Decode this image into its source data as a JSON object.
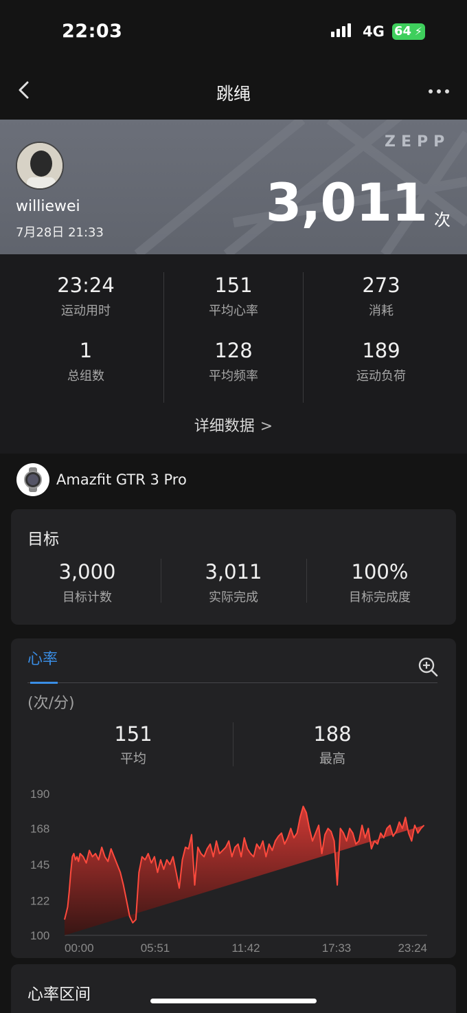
{
  "status_bar": {
    "time": "22:03",
    "network": "4G",
    "battery": "64"
  },
  "nav": {
    "title": "跳绳"
  },
  "hero": {
    "brand": "ZEPP",
    "username": "williewei",
    "datetime": "7月28日 21:33",
    "count": "3,011",
    "count_unit": "次"
  },
  "stats": [
    {
      "value": "23:24",
      "label": "运动用时"
    },
    {
      "value": "151",
      "label": "平均心率"
    },
    {
      "value": "273",
      "label": "消耗"
    },
    {
      "value": "1",
      "label": "总组数"
    },
    {
      "value": "128",
      "label": "平均频率"
    },
    {
      "value": "189",
      "label": "运动负荷"
    }
  ],
  "detail_link": "详细数据",
  "device": {
    "name": "Amazfit GTR 3 Pro"
  },
  "goal": {
    "title": "目标",
    "items": [
      {
        "value": "3,000",
        "label": "目标计数"
      },
      {
        "value": "3,011",
        "label": "实际完成"
      },
      {
        "value": "100%",
        "label": "目标完成度"
      }
    ]
  },
  "heart_rate": {
    "tab": "心率",
    "unit": "(次/分)",
    "avg": {
      "value": "151",
      "label": "平均"
    },
    "max": {
      "value": "188",
      "label": "最高"
    }
  },
  "chart_data": {
    "type": "area",
    "y_ticks": [
      "190",
      "168",
      "145",
      "122",
      "100"
    ],
    "x_ticks": [
      "00:00",
      "05:51",
      "11:42",
      "17:33",
      "23:24"
    ],
    "ylim": [
      100,
      190
    ],
    "xlim": [
      0,
      23.4
    ],
    "x": [
      0.0,
      0.1,
      0.2,
      0.3,
      0.4,
      0.5,
      0.6,
      0.7,
      0.8,
      0.9,
      1.0,
      1.2,
      1.4,
      1.6,
      1.8,
      2.0,
      2.2,
      2.4,
      2.6,
      2.8,
      3.0,
      3.2,
      3.4,
      3.6,
      3.8,
      4.0,
      4.2,
      4.4,
      4.6,
      4.8,
      5.0,
      5.2,
      5.4,
      5.6,
      5.8,
      6.0,
      6.2,
      6.4,
      6.6,
      6.8,
      7.0,
      7.2,
      7.4,
      7.6,
      7.8,
      8.0,
      8.2,
      8.4,
      8.6,
      8.8,
      9.0,
      9.2,
      9.4,
      9.6,
      9.8,
      10.0,
      10.2,
      10.4,
      10.6,
      10.8,
      11.0,
      11.2,
      11.4,
      11.6,
      11.8,
      12.0,
      12.2,
      12.4,
      12.6,
      12.8,
      13.0,
      13.2,
      13.4,
      13.6,
      13.8,
      14.0,
      14.2,
      14.4,
      14.6,
      14.8,
      15.0,
      15.2,
      15.4,
      15.6,
      15.8,
      16.0,
      16.2,
      16.4,
      16.6,
      16.8,
      17.0,
      17.2,
      17.4,
      17.6,
      17.8,
      18.0,
      18.2,
      18.4,
      18.6,
      18.8,
      19.0,
      19.2,
      19.4,
      19.6,
      19.8,
      20.0,
      20.2,
      20.4,
      20.6,
      20.8,
      21.0,
      21.2,
      21.4,
      21.6,
      21.8,
      22.0,
      22.2,
      22.4,
      22.6,
      22.8,
      23.0,
      23.2,
      23.4
    ],
    "values": [
      110,
      114,
      118,
      128,
      140,
      150,
      152,
      148,
      150,
      147,
      152,
      150,
      146,
      154,
      150,
      152,
      148,
      156,
      150,
      147,
      155,
      150,
      145,
      140,
      132,
      122,
      112,
      108,
      110,
      140,
      150,
      148,
      152,
      146,
      150,
      140,
      148,
      142,
      148,
      145,
      150,
      140,
      130,
      148,
      156,
      155,
      164,
      132,
      156,
      152,
      150,
      155,
      158,
      150,
      160,
      152,
      154,
      156,
      160,
      150,
      156,
      158,
      150,
      162,
      155,
      152,
      150,
      158,
      155,
      160,
      150,
      158,
      154,
      160,
      163,
      165,
      158,
      162,
      168,
      162,
      165,
      175,
      182,
      178,
      168,
      160,
      165,
      170,
      152,
      164,
      168,
      166,
      160,
      132,
      168,
      165,
      160,
      168,
      165,
      158,
      160,
      170,
      162,
      168,
      155,
      160,
      158,
      165,
      162,
      168,
      170,
      163,
      166,
      172,
      168,
      175,
      165,
      160,
      170,
      165,
      168,
      170
    ]
  }
}
